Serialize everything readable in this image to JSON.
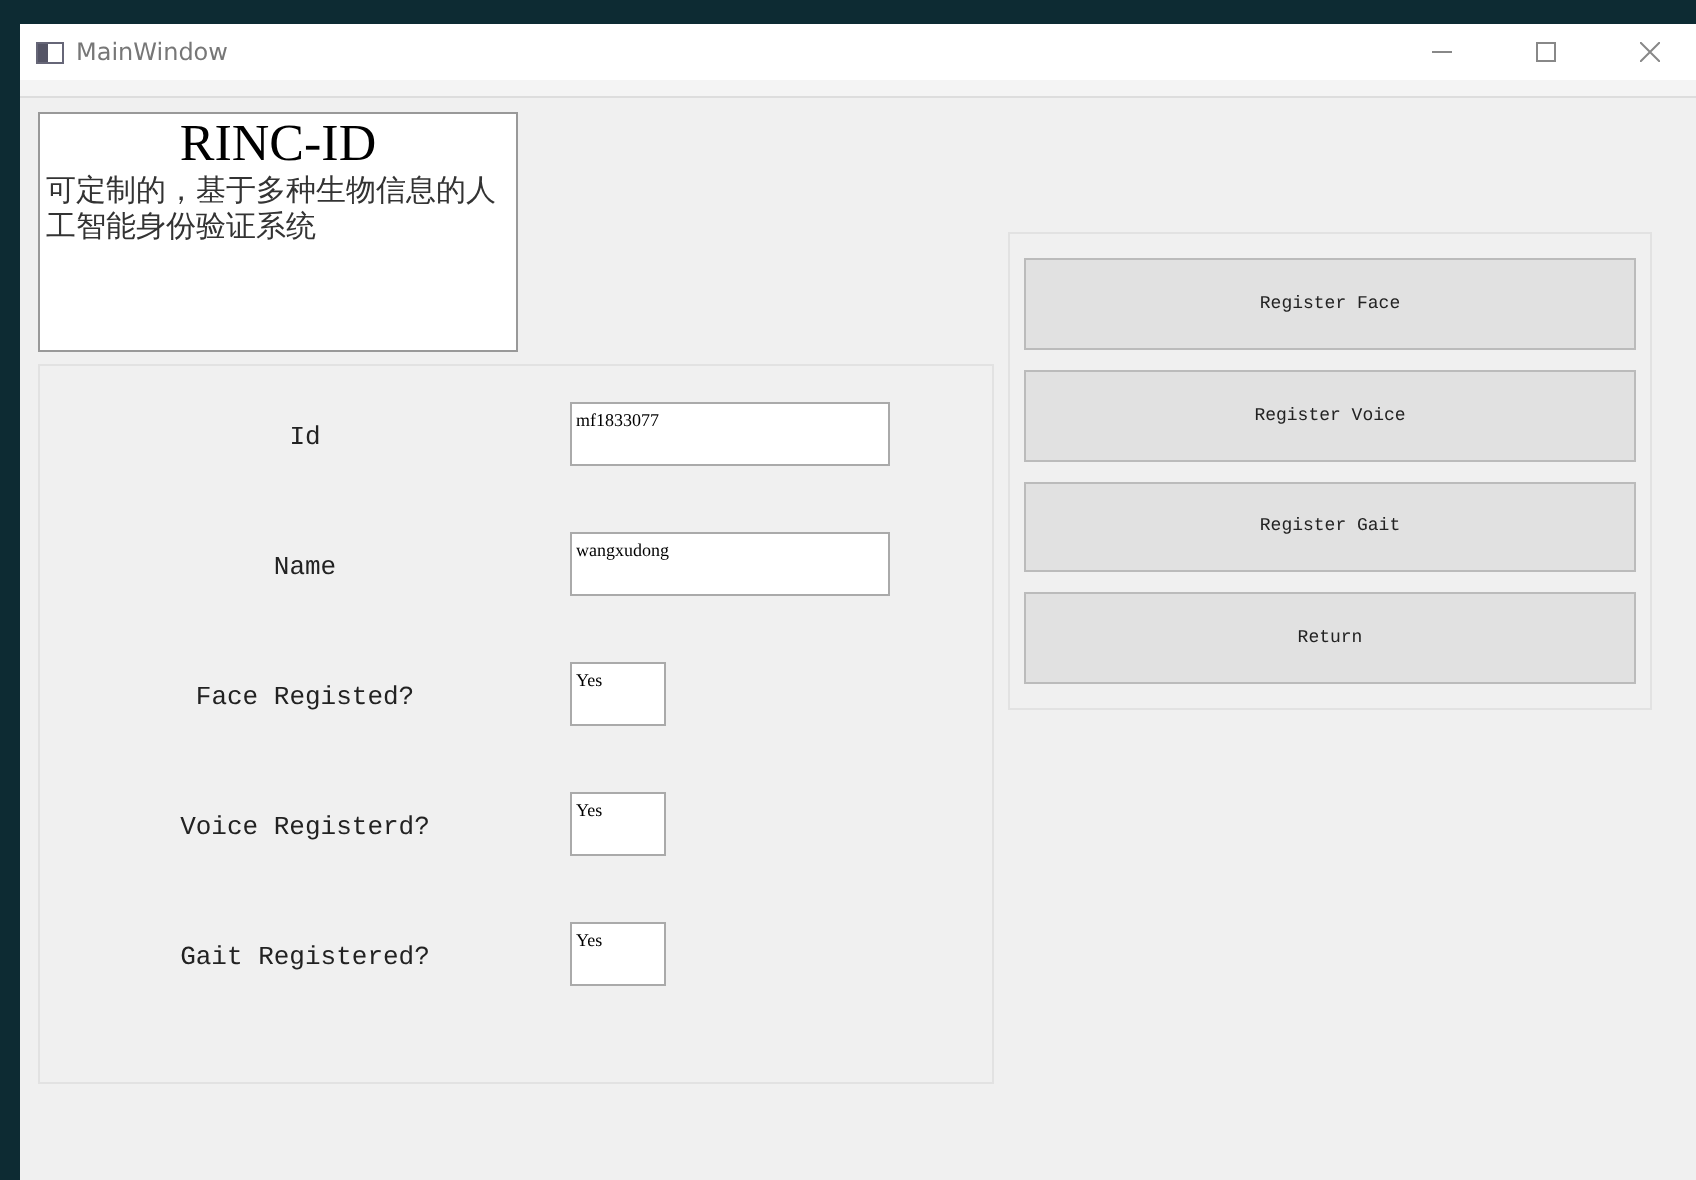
{
  "window": {
    "title": "MainWindow"
  },
  "logo": {
    "title": "RINC-ID",
    "subtitle": "可定制的，基于多种生物信息的人工智能身份验证系统"
  },
  "form": [
    {
      "label": "Id",
      "value": "mf1833077",
      "kind": "wide"
    },
    {
      "label": "Name",
      "value": "wangxudong",
      "kind": "wide"
    },
    {
      "label": "Face Registed?",
      "value": "Yes",
      "kind": "narrow"
    },
    {
      "label": "Voice Registerd?",
      "value": "Yes",
      "kind": "narrow"
    },
    {
      "label": "Gait Registered?",
      "value": "Yes",
      "kind": "narrow"
    }
  ],
  "buttons": [
    "Register Face",
    "Register Voice",
    "Register Gait",
    "Return"
  ]
}
